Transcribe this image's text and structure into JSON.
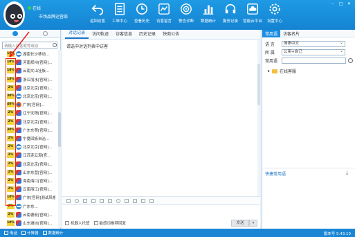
{
  "header": {
    "status": "在线",
    "org_name": "市场品牌运营部",
    "toolbar": [
      {
        "label": "返回访客",
        "icon": "back-arrow-icon"
      },
      {
        "label": "工单中心",
        "icon": "list-icon"
      },
      {
        "label": "查看历史",
        "icon": "clock-icon"
      },
      {
        "label": "访客留言",
        "icon": "message-icon"
      },
      {
        "label": "警告诊断",
        "icon": "target-icon"
      },
      {
        "label": "数据统计",
        "icon": "bar-chart-icon"
      },
      {
        "label": "服务记录",
        "icon": "headset-icon"
      },
      {
        "label": "智能云平台",
        "icon": "cloud-icon"
      },
      {
        "label": "设置中心",
        "icon": "gear-icon"
      }
    ]
  },
  "left": {
    "search_placeholder": "请输入访客昵称或访",
    "visitors": [
      {
        "pct": "10%",
        "name": "湖南长沙移动...",
        "icon": "ie"
      },
      {
        "pct": "10%",
        "name": "河南郑州[官网]...",
        "icon": "mix"
      },
      {
        "pct": "10%",
        "name": "云南文山壮族...",
        "icon": "mix"
      },
      {
        "pct": "10%",
        "name": "浙江丽水[官网]...",
        "icon": "mix"
      },
      {
        "pct": "2%",
        "name": "北京北京[官网]...",
        "icon": "mix"
      },
      {
        "pct": "30%",
        "name": "北京北京[官网]...",
        "icon": "ie"
      },
      {
        "pct": "40%",
        "name": "广东[官网]...",
        "icon": "fx"
      },
      {
        "pct": "2%",
        "name": "辽宁沈阳[官网]...",
        "icon": "mix"
      },
      {
        "pct": "2%",
        "name": "北京北京[官网]...",
        "icon": "mix"
      },
      {
        "pct": "30%",
        "name": "广东东莞[官网]...",
        "icon": "mix"
      },
      {
        "pct": "2%",
        "name": "宁夏回族自治...",
        "icon": "mix"
      },
      {
        "pct": "2%",
        "name": "北京北京[官网]...",
        "icon": "ie"
      },
      {
        "pct": "2%",
        "name": "江苏连云港[官...",
        "icon": "mix"
      },
      {
        "pct": "2%",
        "name": "北京北京[官网]...",
        "icon": "mix"
      },
      {
        "pct": "2%",
        "name": "山东东营[官网]...",
        "icon": "mix"
      },
      {
        "pct": "2%",
        "name": "海南海口[官网]...",
        "icon": "mix"
      },
      {
        "pct": "2%",
        "name": "云南丽江[官网]...",
        "icon": "mix"
      },
      {
        "pct": "10%",
        "name": "广东[官网]测试风格...",
        "icon": "mix"
      },
      {
        "pct": "2%",
        "name": "广东东...",
        "icon": "ie"
      },
      {
        "pct": "2%",
        "name": "云南德宏[官网]...",
        "icon": "mix"
      },
      {
        "pct": "10%",
        "name": "山东潍坊[官网]...",
        "icon": "mix"
      }
    ]
  },
  "main": {
    "tabs": [
      "对话记录",
      "访问轨迹",
      "访客信息",
      "历史记录",
      "快商公告"
    ],
    "hint": "请选中对话列表中访客",
    "robot_reply": "机器人托管",
    "sensitive_recommend": "敏感词推荐回复",
    "send": "发送"
  },
  "right": {
    "tabs": [
      "常用语",
      "访客名片"
    ],
    "language_label": "语 言",
    "language_value": "简体中文",
    "belong_label": "所 属",
    "belong_value": "公用+自己",
    "common_label": "常用语",
    "tree_item": "在线客服",
    "quick_common": "快捷常用语"
  },
  "status_bar": {
    "items": [
      "电话",
      "计算器",
      "数据统计"
    ],
    "version": "版本号 5.43.10"
  },
  "colors": {
    "brand": "#1b8ee1",
    "highlight": "#e8201c",
    "badge": "#f4d23a"
  }
}
